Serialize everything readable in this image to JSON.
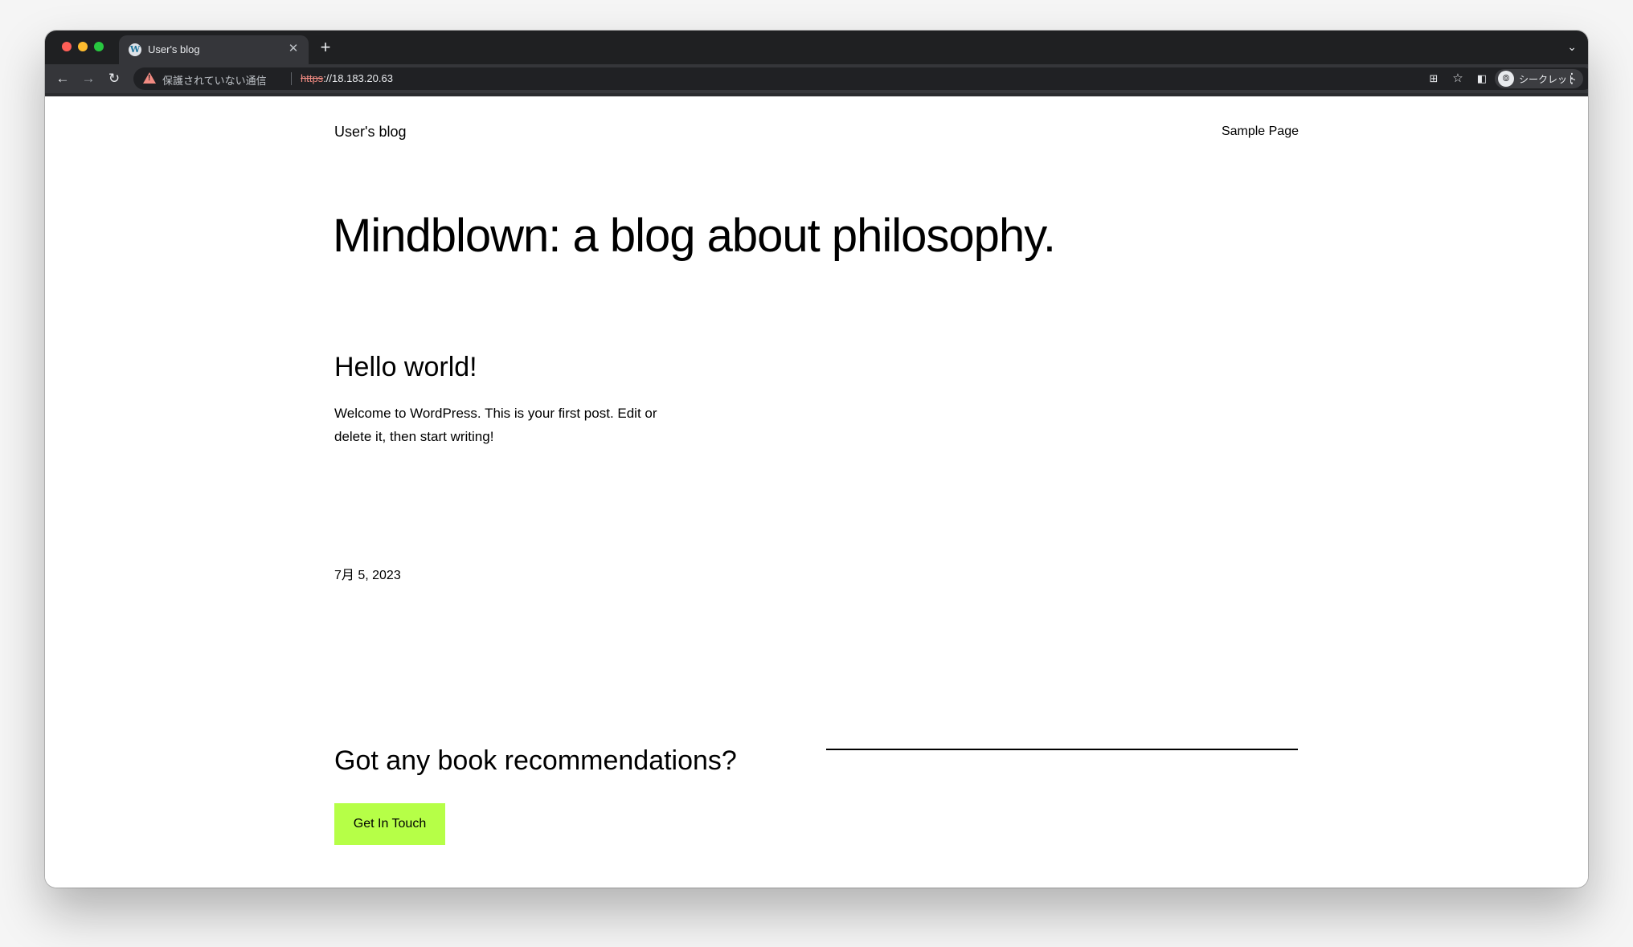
{
  "browser": {
    "tab": {
      "title": "User's blog",
      "favicon": "W",
      "close_glyph": "✕"
    },
    "new_tab_glyph": "+",
    "tab_menu_glyph": "⌄",
    "toolbar": {
      "back_glyph": "←",
      "forward_glyph": "→",
      "reload_glyph": "↻",
      "security_text": "保護されていない通信",
      "url_scheme": "https",
      "url_rest": "://18.183.20.63",
      "qr_glyph": "⊞",
      "star_glyph": "☆",
      "side_panel_glyph": "◧",
      "incognito_glyph": "⦾",
      "incognito_label": "シークレット",
      "menu_glyph": "⋮"
    }
  },
  "page": {
    "site_title": "User's blog",
    "nav_link": "Sample Page",
    "hero_heading": "Mindblown: a blog about philosophy.",
    "post": {
      "title": "Hello world!",
      "excerpt": "Welcome to WordPress. This is your first post. Edit or delete it, then start writing!",
      "date": "7月 5, 2023"
    },
    "cta": {
      "heading": "Got any book recommendations?",
      "button_label": "Get In Touch",
      "button_color": "#b6ff47"
    }
  }
}
